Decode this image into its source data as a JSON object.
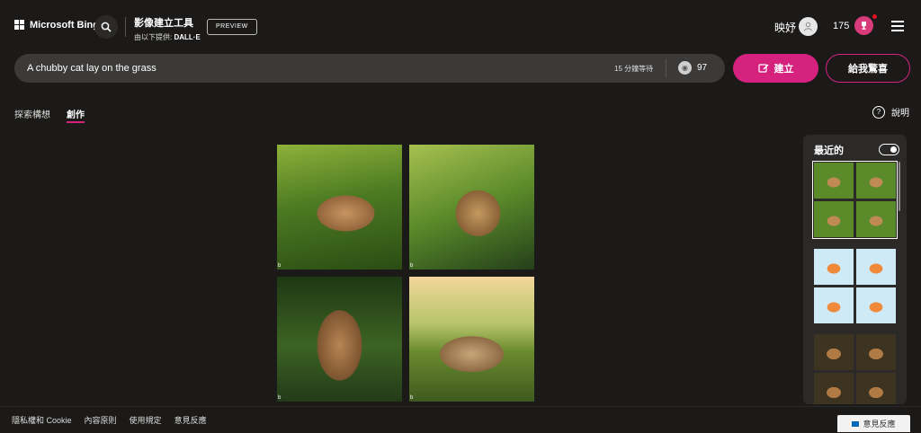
{
  "header": {
    "logo_text": "Microsoft Bing",
    "product_title": "影像建立工具",
    "product_subtitle_prefix": "由以下提供:",
    "product_subtitle_brand": "DALL·E",
    "preview_label": "PREVIEW",
    "user_name": "映妤",
    "points": "175"
  },
  "prompt": {
    "value": "A chubby cat lay on the grass",
    "wait_text": "15 分鐘等待",
    "boosts": "97"
  },
  "buttons": {
    "create_label": "建立",
    "surprise_label": "給我驚喜"
  },
  "tabs": [
    {
      "label": "探索構想"
    },
    {
      "label": "創作"
    }
  ],
  "help_label": "說明",
  "results": {
    "images": [
      {
        "badge": "b"
      },
      {
        "badge": "b"
      },
      {
        "badge": "b"
      },
      {
        "badge": "b"
      }
    ]
  },
  "recent": {
    "title": "最近的"
  },
  "footer": {
    "links": [
      "隱私權和 Cookie",
      "內容原則",
      "使用規定",
      "意見反應"
    ],
    "feedback_button": "意見反應"
  },
  "colors": {
    "background": "#1b1a19",
    "accent": "#d6227f",
    "prompt_bg": "#3b3a39"
  }
}
